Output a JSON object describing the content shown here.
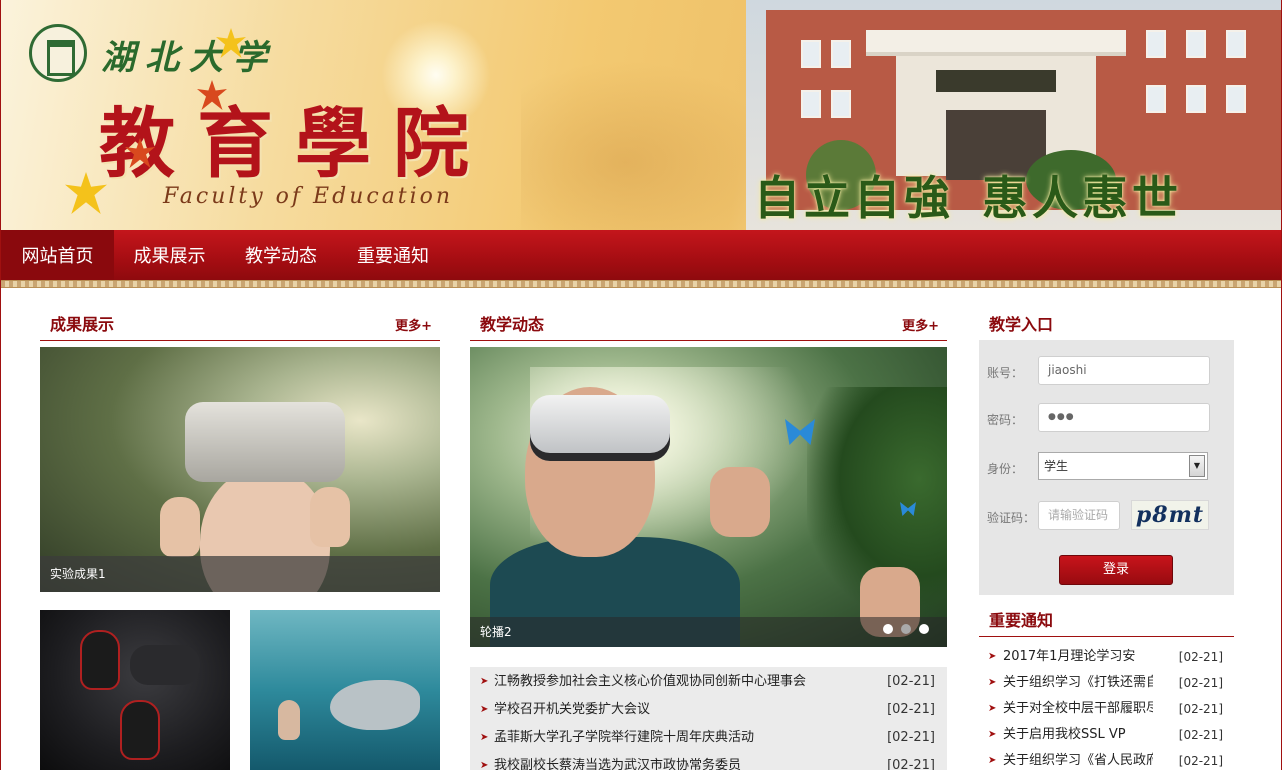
{
  "banner": {
    "university_name": "湖北大学",
    "faculty_cn": "教育學院",
    "faculty_en": "Faculty of Education",
    "motto_left": "自立自強",
    "motto_right": "惠人惠世"
  },
  "nav": {
    "items": [
      {
        "label": "网站首页",
        "active": true
      },
      {
        "label": "成果展示",
        "active": false
      },
      {
        "label": "教学动态",
        "active": false
      },
      {
        "label": "重要通知",
        "active": false
      }
    ]
  },
  "achievements": {
    "title": "成果展示",
    "more": "更多+",
    "featured_caption": "实验成果1"
  },
  "teaching": {
    "title": "教学动态",
    "more": "更多+",
    "carousel_caption": "轮播2",
    "carousel_active_index": 2,
    "news": [
      {
        "title": "江畅教授参加社会主义核心价值观协同创新中心理事会",
        "date": "[02-21]"
      },
      {
        "title": "学校召开机关党委扩大会议",
        "date": "[02-21]"
      },
      {
        "title": "孟菲斯大学孔子学院举行建院十周年庆典活动",
        "date": "[02-21]"
      },
      {
        "title": "我校副校长蔡涛当选为武汉市政协常务委员",
        "date": "[02-21]"
      }
    ]
  },
  "login": {
    "title": "教学入口",
    "account_label": "账号：",
    "account_value": "jiaoshi",
    "password_label": "密码：",
    "password_mask": "●●●",
    "identity_label": "身份：",
    "identity_value": "学生",
    "captcha_label": "验证码：",
    "captcha_placeholder": "请输验证码",
    "captcha_text": "p8mt",
    "submit": "登录"
  },
  "notices": {
    "title": "重要通知",
    "items": [
      {
        "title": "2017年1月理论学习安",
        "date": "[02-21]"
      },
      {
        "title": "关于组织学习《打铁还需自",
        "date": "[02-21]"
      },
      {
        "title": "关于对全校中层干部履职尽",
        "date": "[02-21]"
      },
      {
        "title": "关于启用我校SSL VP",
        "date": "[02-21]"
      },
      {
        "title": "关于组织学习《省人民政府",
        "date": "[02-21]"
      }
    ]
  },
  "colors": {
    "brand_red": "#a50d12",
    "title_red": "#8b0a0e",
    "panel_gray": "#e6e6e6"
  }
}
